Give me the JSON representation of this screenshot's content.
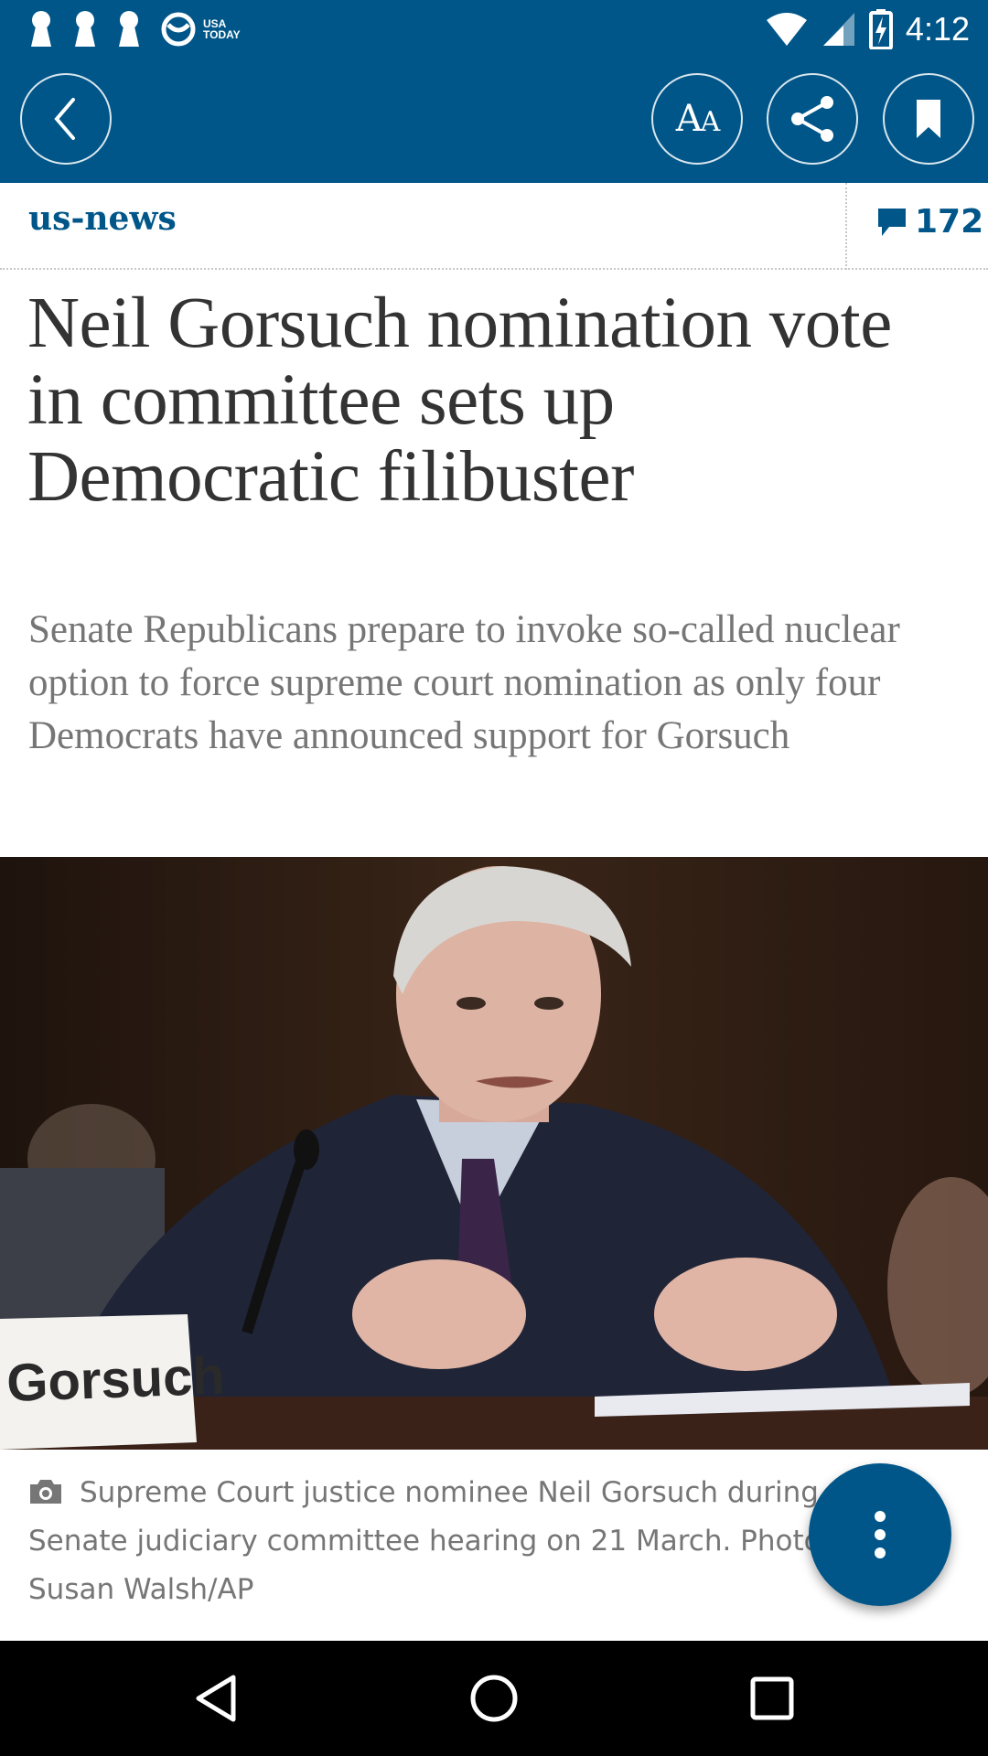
{
  "status_bar": {
    "time": "4:12",
    "notification_icons": [
      "keyhole-icon",
      "keyhole-icon",
      "keyhole-icon",
      "usa-today-icon"
    ],
    "usa_today_label_line1": "USA",
    "usa_today_label_line2": "TODAY",
    "system_icons": [
      "wifi-icon",
      "cell-signal-icon",
      "battery-charging-icon"
    ]
  },
  "toolbar": {
    "back_icon": "chevron-left-icon",
    "text_size_label_big": "A",
    "text_size_label_small": "A",
    "share_icon": "share-icon",
    "bookmark_icon": "bookmark-icon"
  },
  "article": {
    "section": "us-news",
    "comment_count": "172",
    "headline": "Neil Gorsuch nomination vote in committee sets up Democratic filibuster",
    "standfirst": "Senate Republicans prepare to invoke so-called nuclear option to force supreme court nomination as only four Democrats have announced support for Gorsuch",
    "photo_nameplate": "Gorsuch",
    "caption": "Supreme Court justice nominee Neil Gorsuch during a Senate judiciary committee hearing on 21 March. Photograph: Susan Walsh/AP"
  },
  "colors": {
    "brand_blue": "#005689",
    "headline_text": "#333333",
    "standfirst_text": "#767676"
  },
  "nav_bar": {
    "icons": [
      "nav-back-icon",
      "nav-home-icon",
      "nav-recents-icon"
    ]
  }
}
